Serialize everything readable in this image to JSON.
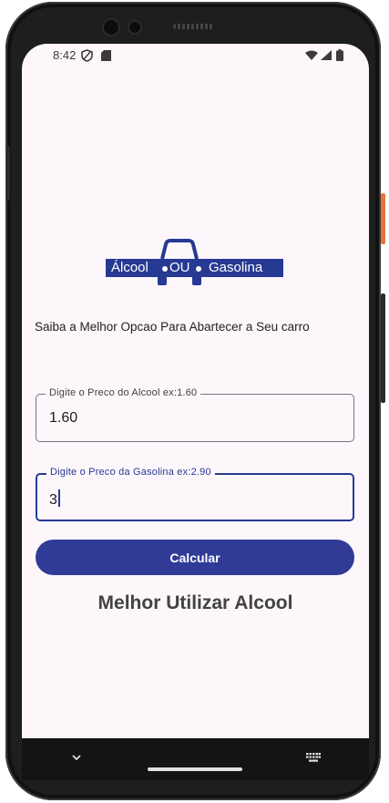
{
  "status_bar": {
    "time": "8:42",
    "icons": [
      "shield-icon",
      "sd-card-icon",
      "wifi-icon",
      "signal-icon",
      "battery-icon"
    ]
  },
  "logo": {
    "left_text": "Álcool",
    "middle_text": "OU",
    "right_text": "Gasolina",
    "bar_color": "#263a93"
  },
  "subtitle": "Saiba a Melhor Opcao Para Abartecer a Seu carro",
  "alcohol_field": {
    "label": "Digite o Preco do Alcool ex:1.60",
    "value": "1.60"
  },
  "gasoline_field": {
    "label": "Digite o Preco da Gasolina ex:2.90",
    "value": "3"
  },
  "calculate_button": {
    "label": "Calcular",
    "color": "#2f3b96"
  },
  "result_text": "Melhor Utilizar Alcool",
  "navigation_bar": {
    "icons": [
      "chevron-down-icon",
      "home-pill",
      "keyboard-icon"
    ]
  }
}
